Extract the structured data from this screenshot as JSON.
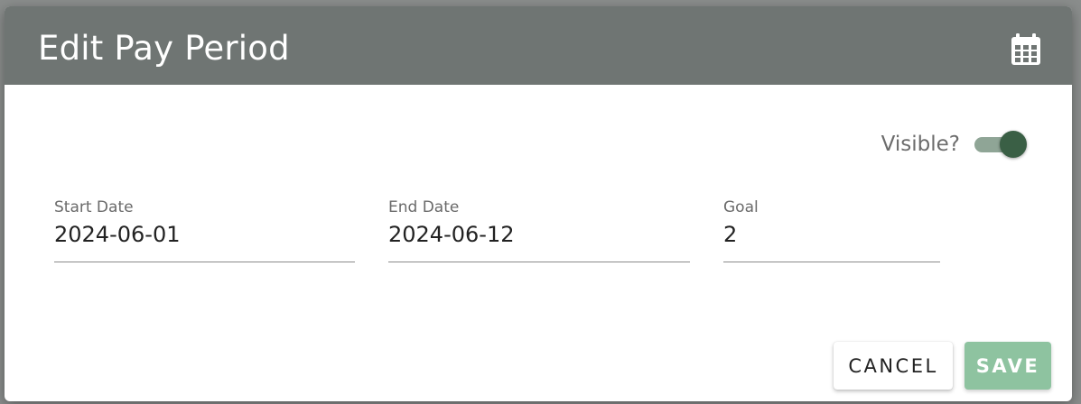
{
  "dialog": {
    "title": "Edit Pay Period",
    "header_icon": "calendar-icon",
    "header_color": "#6f7573"
  },
  "visible": {
    "label": "Visible?",
    "checked": true,
    "accent_color": "#3a5f45"
  },
  "fields": {
    "start_date": {
      "label": "Start Date",
      "value": "2024-06-01"
    },
    "end_date": {
      "label": "End Date",
      "value": "2024-06-12"
    },
    "goal": {
      "label": "Goal",
      "value": "2"
    }
  },
  "actions": {
    "cancel_label": "CANCEL",
    "save_label": "SAVE",
    "save_color": "#8ec3a0"
  }
}
